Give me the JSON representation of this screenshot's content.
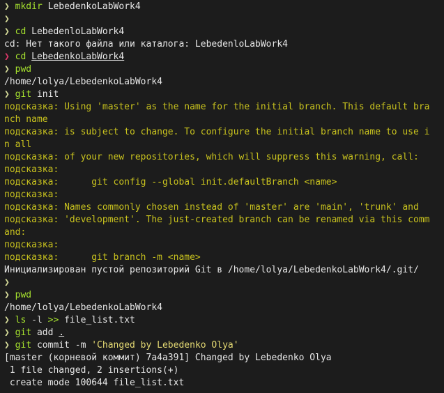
{
  "theme": {
    "background": "#1c1c1c",
    "foreground": "#e6e6e6",
    "prompt_ok": "#d6dc9a",
    "prompt_error": "#e0386b",
    "command": "#a6e22e",
    "hint": "#c8c21e",
    "string": "#e6db74"
  },
  "prompt_symbol": "❯",
  "lines": [
    {
      "kind": "cmd",
      "prompt": "❯",
      "cmd": "mkdir",
      "rest": " LebedenkoLabWork4"
    },
    {
      "kind": "empty_prompt",
      "prompt": "❯"
    },
    {
      "kind": "cmd",
      "prompt": "❯",
      "cmd": "cd",
      "rest": " LebedenloLabWork4"
    },
    {
      "kind": "out",
      "text": "cd: Нет такого файла или каталога: LebedenloLabWork4"
    },
    {
      "kind": "cmd_err_ul",
      "prompt": "❯",
      "cmd": "cd",
      "space": " ",
      "ul": "LebedenkoLabWork4"
    },
    {
      "kind": "cmd",
      "prompt": "❯",
      "cmd": "pwd",
      "rest": ""
    },
    {
      "kind": "out",
      "text": "/home/lolya/LebedenkoLabWork4"
    },
    {
      "kind": "cmd",
      "prompt": "❯",
      "cmd": "git",
      "rest": " init"
    },
    {
      "kind": "hint",
      "text": "подсказка: Using 'master' as the name for the initial branch. This default bra"
    },
    {
      "kind": "hint",
      "text": "nch name"
    },
    {
      "kind": "hint",
      "text": "подсказка: is subject to change. To configure the initial branch name to use i"
    },
    {
      "kind": "hint",
      "text": "n all"
    },
    {
      "kind": "hint",
      "text": "подсказка: of your new repositories, which will suppress this warning, call:"
    },
    {
      "kind": "hint",
      "text": "подсказка:"
    },
    {
      "kind": "hint",
      "text": "подсказка:      git config --global init.defaultBranch <name>"
    },
    {
      "kind": "hint",
      "text": "подсказка:"
    },
    {
      "kind": "hint",
      "text": "подсказка: Names commonly chosen instead of 'master' are 'main', 'trunk' and"
    },
    {
      "kind": "hint",
      "text": "подсказка: 'development'. The just-created branch can be renamed via this comm"
    },
    {
      "kind": "hint",
      "text": "and:"
    },
    {
      "kind": "hint",
      "text": "подсказка:"
    },
    {
      "kind": "hint",
      "text": "подсказка:      git branch -m <name>"
    },
    {
      "kind": "out",
      "text": "Инициализирован пустой репозиторий Git в /home/lolya/LebedenkoLabWork4/.git/"
    },
    {
      "kind": "empty_prompt",
      "prompt": "❯"
    },
    {
      "kind": "cmd",
      "prompt": "❯",
      "cmd": "pwd",
      "rest": ""
    },
    {
      "kind": "out",
      "text": "/home/lolya/LebedenkoLabWork4"
    },
    {
      "kind": "cmd_redirect",
      "prompt": "❯",
      "cmd": "ls",
      "flag": " -l ",
      "op": ">>",
      "rest": " file_list.txt"
    },
    {
      "kind": "cmd_ul",
      "prompt": "❯",
      "cmd": "git",
      "space": " add ",
      "ul": "."
    },
    {
      "kind": "cmd_str",
      "prompt": "❯",
      "cmd": "git",
      "rest": " commit -m ",
      "str": "'Changed by Lebedenko Olya'"
    },
    {
      "kind": "out",
      "text": "[master (корневой коммит) 7a4a391] Changed by Lebedenko Olya"
    },
    {
      "kind": "out",
      "text": " 1 file changed, 2 insertions(+)"
    },
    {
      "kind": "out",
      "text": " create mode 100644 file_list.txt"
    }
  ]
}
